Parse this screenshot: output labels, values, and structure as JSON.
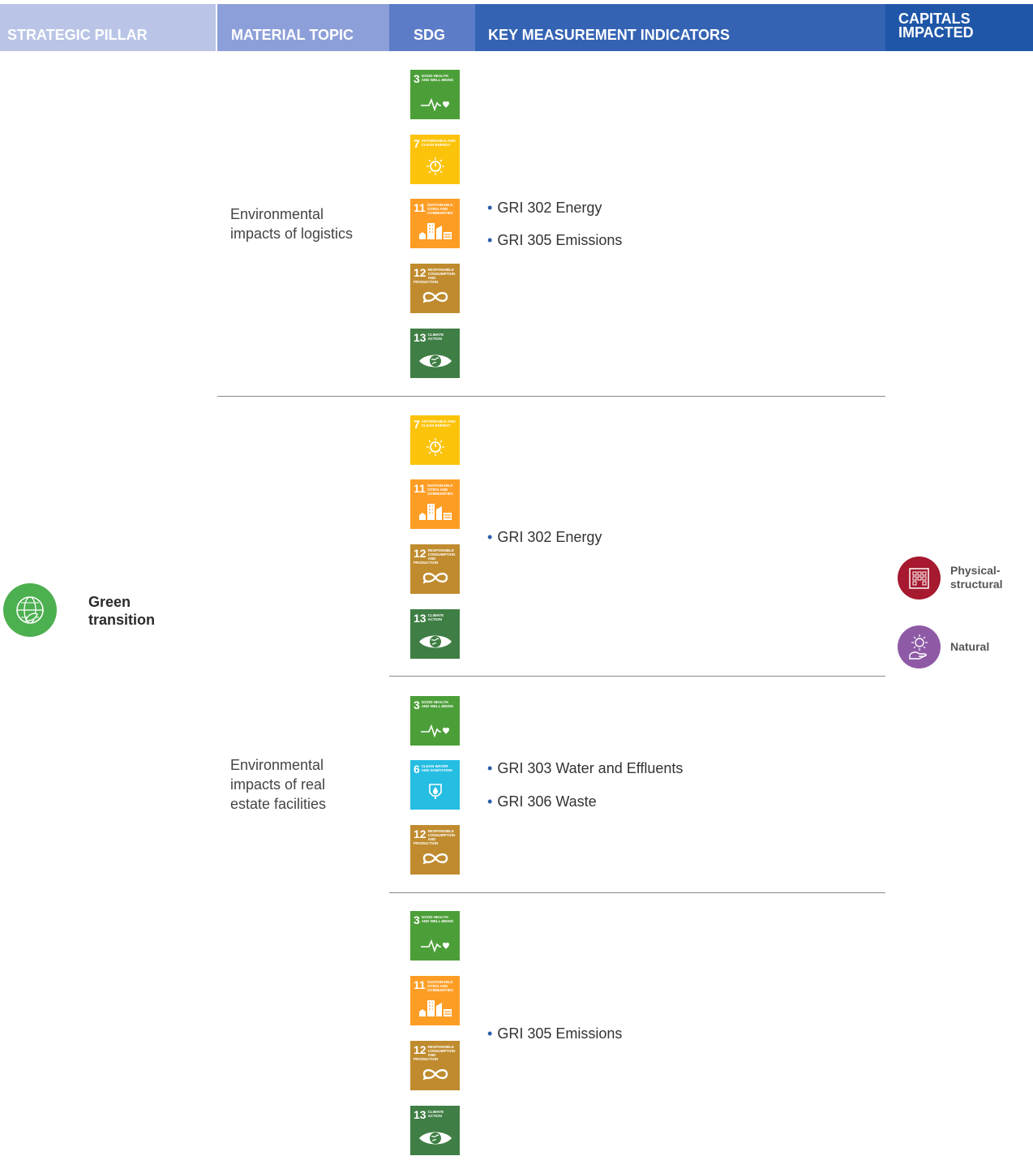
{
  "header": {
    "strategic_pillar": "STRATEGIC PILLAR",
    "material_topic": "MATERIAL TOPIC",
    "sdg": "SDG",
    "key_indicators": "KEY MEASUREMENT INDICATORS",
    "capitals_impacted": "CAPITALS\nIMPACTED"
  },
  "pillar": {
    "label": "Green\ntransition",
    "icon": "globe-leaf-icon",
    "color": "#4caf50"
  },
  "capitals": [
    {
      "label": "Physical-\nstructural",
      "icon": "building-icon",
      "color": "#a6192e"
    },
    {
      "label": "Natural",
      "icon": "hand-sun-icon",
      "color": "#8e5aa6"
    }
  ],
  "sdg_goals": {
    "3": {
      "number": "3",
      "title": "Good health and well-being",
      "color": "#4c9f38",
      "icon": "heartbeat-icon"
    },
    "6": {
      "number": "6",
      "title": "Clean water and sanitation",
      "color": "#26bde2",
      "icon": "water-drop-icon"
    },
    "7": {
      "number": "7",
      "title": "Affordable and clean energy",
      "color": "#fcc30b",
      "icon": "sun-power-icon"
    },
    "11": {
      "number": "11",
      "title": "Sustainable cities and communities",
      "color": "#fd9d24",
      "icon": "city-icon"
    },
    "12": {
      "number": "12",
      "title": "Responsible consumption and production",
      "color": "#bf8b2e",
      "icon": "infinity-icon"
    },
    "13": {
      "number": "13",
      "title": "Climate action",
      "color": "#3f7e44",
      "icon": "eye-globe-icon"
    }
  },
  "rows": [
    {
      "topic": "Environmental\nimpacts of logistics",
      "sdgs": [
        "3",
        "7",
        "11",
        "12",
        "13"
      ],
      "indicators": [
        "GRI 302 Energy",
        "GRI 305 Emissions"
      ]
    },
    {
      "topic": "",
      "sdgs": [
        "7",
        "11",
        "12",
        "13"
      ],
      "indicators": [
        "GRI 302 Energy"
      ]
    },
    {
      "topic": "Environmental\nimpacts of real\nestate facilities",
      "sdgs": [
        "3",
        "6",
        "12"
      ],
      "indicators": [
        "GRI 303 Water and Effluents",
        "GRI 306 Waste"
      ]
    },
    {
      "topic": "",
      "sdgs": [
        "3",
        "11",
        "12",
        "13"
      ],
      "indicators": [
        "GRI 305 Emissions"
      ]
    }
  ],
  "bullet": "•"
}
